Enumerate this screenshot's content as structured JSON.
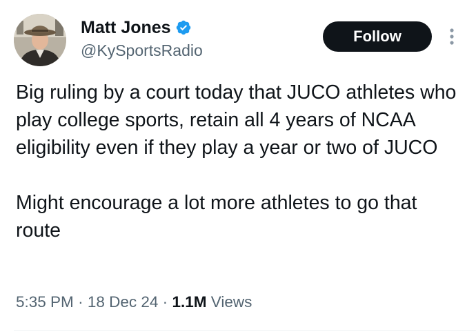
{
  "author": {
    "name": "Matt Jones",
    "handle": "@KySportsRadio",
    "verified": true
  },
  "actions": {
    "follow_label": "Follow",
    "more_icon": "more-vertical-icon"
  },
  "tweet": {
    "paragraphs": [
      "Big ruling by a court today that JUCO athletes who play college sports, retain all 4 years of NCAA eligibility even if they play a year or two of JUCO",
      "Might encourage a lot more athletes to go that route"
    ]
  },
  "meta": {
    "time": "5:35 PM",
    "separator": "·",
    "date": "18 Dec 24",
    "views_count": "1.1M",
    "views_label": "Views"
  },
  "colors": {
    "text": "#0f1419",
    "secondary": "#536471",
    "verified": "#1d9bf0",
    "button_bg": "#0f1419"
  }
}
